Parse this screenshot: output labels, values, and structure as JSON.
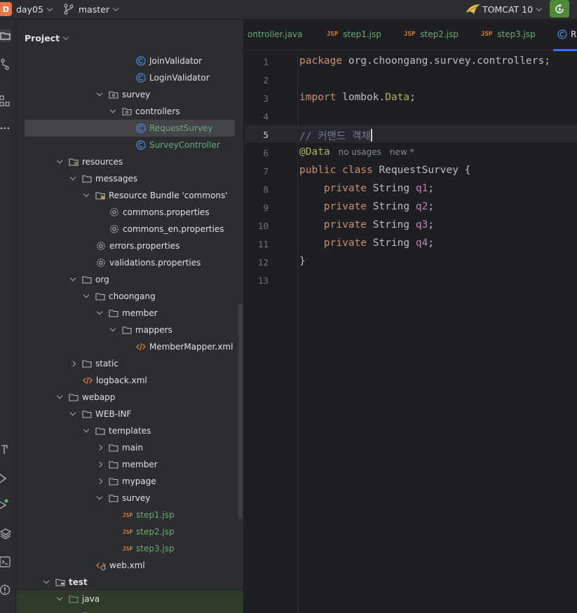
{
  "topbar": {
    "project_badge": "D",
    "project_name": "day05",
    "branch": "master",
    "run_config": "TOMCAT 10"
  },
  "project_panel": {
    "title": "Project",
    "items": [
      {
        "label": "JoinValidator"
      },
      {
        "label": "LoginValidator"
      },
      {
        "label": "survey"
      },
      {
        "label": "controllers"
      },
      {
        "label": "RequestSurvey"
      },
      {
        "label": "SurveyController"
      },
      {
        "label": "resources"
      },
      {
        "label": "messages"
      },
      {
        "label": "Resource Bundle 'commons'"
      },
      {
        "label": "commons.properties"
      },
      {
        "label": "commons_en.properties"
      },
      {
        "label": "errors.properties"
      },
      {
        "label": "validations.properties"
      },
      {
        "label": "org"
      },
      {
        "label": "choongang"
      },
      {
        "label": "member"
      },
      {
        "label": "mappers"
      },
      {
        "label": "MemberMapper.xml"
      },
      {
        "label": "static"
      },
      {
        "label": "logback.xml"
      },
      {
        "label": "webapp"
      },
      {
        "label": "WEB-INF"
      },
      {
        "label": "templates"
      },
      {
        "label": "main"
      },
      {
        "label": "member"
      },
      {
        "label": "mypage"
      },
      {
        "label": "survey"
      },
      {
        "label": "step1.jsp"
      },
      {
        "label": "step2.jsp"
      },
      {
        "label": "step3.jsp"
      },
      {
        "label": "web.xml"
      },
      {
        "label": "test"
      },
      {
        "label": "java"
      }
    ]
  },
  "editor": {
    "tabs": [
      {
        "label": "ontroller.java"
      },
      {
        "label": "step1.jsp",
        "badge": "JSP"
      },
      {
        "label": "step2.jsp",
        "badge": "JSP"
      },
      {
        "label": "step3.jsp",
        "badge": "JSP"
      },
      {
        "label": "R"
      }
    ],
    "line_numbers": [
      "1",
      "2",
      "3",
      "4",
      "5",
      "6",
      "7",
      "8",
      "9",
      "10",
      "11",
      "12",
      "13"
    ],
    "code": {
      "l1_kw": "package",
      "l1_rest": " org.choongang.survey.controllers;",
      "l3_kw": "import",
      "l3_rest1": " lombok.",
      "l3_ann": "Data",
      "l3_rest2": ";",
      "l5_comment": "// 커맨드 객체",
      "l6_ann": "@Data",
      "l6_hint1": "no usages",
      "l6_hint2": "new *",
      "l7_kw": "public class",
      "l7_rest": " RequestSurvey {",
      "private_kw": "private",
      "string_type": " String ",
      "fields": [
        "q1",
        "q2",
        "q3",
        "q4"
      ],
      "semicolon": ";",
      "close": "}"
    }
  },
  "colors": {
    "background": "#1e1f22",
    "panel": "#2b2d30",
    "accent": "#3574f0",
    "keyword": "#cf8e6d",
    "annotation": "#b3ae60",
    "field": "#c77dbb",
    "git_added": "#6aab73"
  }
}
